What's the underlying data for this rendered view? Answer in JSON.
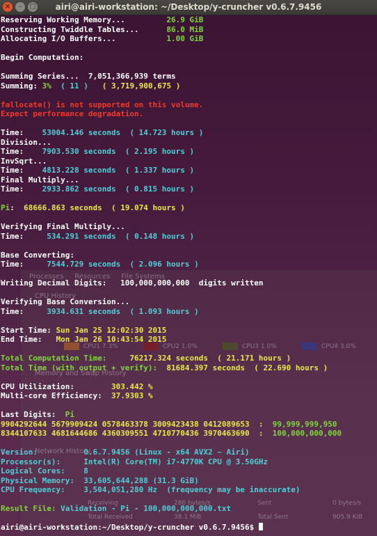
{
  "window": {
    "title": "airi@airi-workstation: ~/Desktop/y-cruncher v0.6.7.9456",
    "buttons": {
      "close": "×",
      "minimize": "–",
      "maximize": "□"
    }
  },
  "background_window": {
    "tabs": [
      "Processes",
      "Resources",
      "File Systems"
    ],
    "cpu_history": "CPU History",
    "memory_history": "Memory and Swap History",
    "network_history": "Network History",
    "cpus": [
      {
        "label": "CPU1 7.3%",
        "color": "#d0741c"
      },
      {
        "label": "CPU2 1.0%",
        "color": "#8a1418"
      },
      {
        "label": "CPU3 1.0%",
        "color": "#4a5a1a"
      },
      {
        "label": "CPU4 3.0%",
        "color": "#2a3a9a"
      }
    ],
    "receiving": "Receiving",
    "receiving_value": "286 bytes/s",
    "total_received": "Total Received",
    "total_received_value": "38.1 MiB",
    "sent": "Sent",
    "sent_value": "0 bytes/s",
    "total_sent": "Total Sent",
    "total_sent_value": "905.9 KiB"
  },
  "terminal": {
    "lines": [
      [
        [
          "w",
          "Reserving Working Memory...         "
        ],
        [
          "g",
          "26.9 GiB"
        ]
      ],
      [
        [
          "w",
          "Constructing Twiddle Tables...      "
        ],
        [
          "g",
          "86.0 MiB"
        ]
      ],
      [
        [
          "w",
          "Allocating I/O Buffers...           "
        ],
        [
          "g",
          "1.00 GiB"
        ]
      ],
      [],
      [
        [
          "w",
          "Begin Computation:"
        ]
      ],
      [],
      [
        [
          "w",
          "Summing Series...  7,051,366,939 terms"
        ]
      ],
      [
        [
          "w",
          "Summing: "
        ],
        [
          "g",
          "3%"
        ],
        [
          "w",
          "  "
        ],
        [
          "c",
          "( 11 )"
        ],
        [
          "w",
          "   "
        ],
        [
          "y",
          "( 3,719,900,675 )"
        ]
      ],
      [],
      [
        [
          "r",
          "fallocate() is not supported on this volume."
        ]
      ],
      [
        [
          "r",
          "Expect performance degradation."
        ]
      ],
      [],
      [
        [
          "w",
          "Time:    "
        ],
        [
          "c",
          "53004.146 seconds  ( 14.723 hours )"
        ]
      ],
      [
        [
          "w",
          "Division..."
        ]
      ],
      [
        [
          "w",
          "Time:    "
        ],
        [
          "c",
          "7903.530 seconds  ( 2.195 hours )"
        ]
      ],
      [
        [
          "w",
          "InvSqrt..."
        ]
      ],
      [
        [
          "w",
          "Time:    "
        ],
        [
          "c",
          "4813.228 seconds  ( 1.337 hours )"
        ]
      ],
      [
        [
          "w",
          "Final Multiply..."
        ]
      ],
      [
        [
          "w",
          "Time:    "
        ],
        [
          "c",
          "2933.862 seconds  ( 0.815 hours )"
        ]
      ],
      [],
      [
        [
          "g",
          "Pi"
        ],
        [
          "w",
          ":  "
        ],
        [
          "y",
          "68666.863 seconds  ( 19.074 hours )"
        ]
      ],
      [],
      [
        [
          "w",
          "Verifying Final Multiply..."
        ]
      ],
      [
        [
          "w",
          "Time:     "
        ],
        [
          "c",
          "534.291 seconds  ( 0.148 hours )"
        ]
      ],
      [],
      [
        [
          "w",
          "Base Converting:"
        ]
      ],
      [
        [
          "w",
          "Time:     "
        ],
        [
          "c",
          "7544.729 seconds  ( 2.096 hours )"
        ]
      ],
      [],
      [
        [
          "w",
          "Writing Decimal Digits:   100,000,000,000  digits written"
        ]
      ],
      [],
      [
        [
          "w",
          "Verifying Base Conversion..."
        ]
      ],
      [
        [
          "w",
          "Time:     "
        ],
        [
          "c",
          "3934.631 seconds  ( 1.093 hours )"
        ]
      ],
      [],
      [
        [
          "w",
          "Start Time: "
        ],
        [
          "y",
          "Sun Jan 25 12:02:30 2015"
        ]
      ],
      [
        [
          "w",
          "End Time:   "
        ],
        [
          "y",
          "Mon Jan 26 10:43:54 2015"
        ]
      ],
      [],
      [
        [
          "g",
          "Total Computation Time:     "
        ],
        [
          "y",
          "76217.324 seconds  ( 21.171 hours )"
        ]
      ],
      [
        [
          "g",
          "Total Time (with output + verify):  "
        ],
        [
          "y",
          "81684.397 seconds  ( 22.690 hours )"
        ]
      ],
      [],
      [
        [
          "w",
          "CPU Utilization:        "
        ],
        [
          "y",
          "303.442 %"
        ]
      ],
      [
        [
          "w",
          "Multi-core Efficiency:  "
        ],
        [
          "y",
          "37.9303 %"
        ]
      ],
      [],
      [
        [
          "w",
          "Last Digits:  "
        ],
        [
          "g",
          "Pi"
        ]
      ],
      [
        [
          "y",
          "9904292644 5679909424 0578463378 3009423438 0412089653  :  "
        ],
        [
          "g",
          "99,999,999,950"
        ]
      ],
      [
        [
          "y",
          "8344107633 4681644686 4360309551 4710770436 3970463690  :  "
        ],
        [
          "g",
          "100,000,000,000"
        ]
      ],
      [],
      [
        [
          "c",
          "Version:          "
        ],
        [
          "c",
          "0.6.7.9456 (Linux - x64 AVX2 ~ Airi)"
        ]
      ],
      [
        [
          "c",
          "Processor(s):     "
        ],
        [
          "c",
          "Intel(R) Core(TM) i7-4770K CPU @ 3.50GHz"
        ]
      ],
      [
        [
          "c",
          "Logical Cores:    "
        ],
        [
          "c",
          "8"
        ]
      ],
      [
        [
          "c",
          "Physical Memory:  "
        ],
        [
          "c",
          "33,605,644,288 (31.3 GiB)"
        ]
      ],
      [
        [
          "c",
          "CPU Frequency:    "
        ],
        [
          "c",
          "3,504,051,280 Hz  (frequency may be inaccurate)"
        ]
      ],
      [],
      [
        [
          "g",
          "Result File: "
        ],
        [
          "c",
          "Validation - Pi - 100,000,000,000.txt"
        ]
      ],
      [],
      [
        [
          "w",
          "airi@airi-workstation:~/Desktop/y-cruncher v0.6.7.9456$ "
        ]
      ]
    ]
  }
}
